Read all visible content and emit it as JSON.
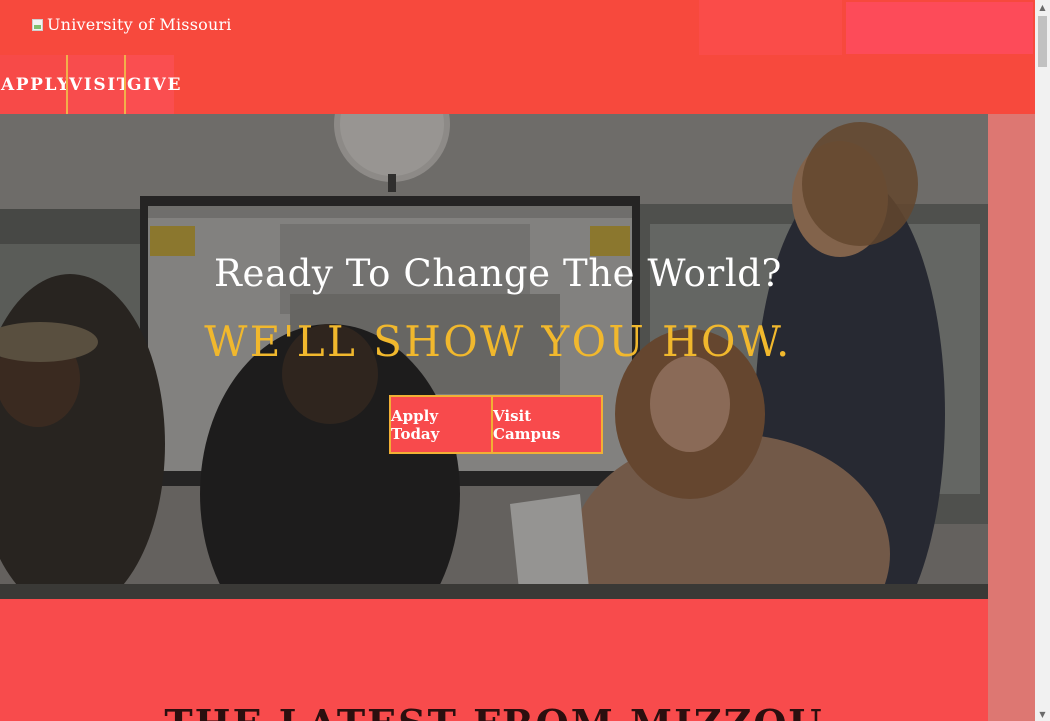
{
  "header": {
    "logo_alt_text": "University of Missouri",
    "nav_items": [
      {
        "label": "APPLY"
      },
      {
        "label": "VISIT"
      },
      {
        "label": "GIVE"
      }
    ]
  },
  "hero": {
    "title": "Ready To Change The World?",
    "tagline": "WE'LL SHOW YOU HOW.",
    "buttons": [
      {
        "label": "Apply Today"
      },
      {
        "label": "Visit Campus"
      }
    ]
  },
  "latest": {
    "heading": "THE LATEST FROM MIZZOU"
  },
  "colors": {
    "header_bg": "#f7493d",
    "accent_gold": "#f1b82d",
    "button_border": "#f1b035",
    "section_bg": "#f84b4c",
    "side_bg": "#dd7772"
  },
  "icons": {
    "logo": "broken-image-icon",
    "scroll_up": "chevron-up-icon",
    "scroll_down": "chevron-down-icon"
  }
}
